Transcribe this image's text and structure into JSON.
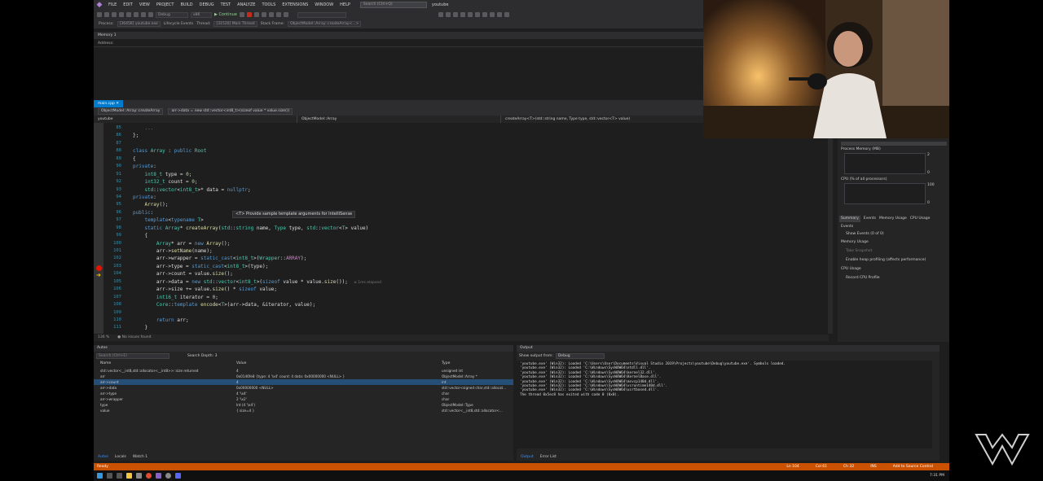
{
  "menu": [
    "FILE",
    "EDIT",
    "VIEW",
    "PROJECT",
    "BUILD",
    "DEBUG",
    "TEST",
    "ANALYZE",
    "TOOLS",
    "EXTENSIONS",
    "WINDOW",
    "HELP"
  ],
  "search_placeholder": "Search (Ctrl+Q)",
  "solution_name": "youtube",
  "toolbar": {
    "config": "Debug",
    "platform": "x86",
    "continue_label": "Continue",
    "stack_label": "Stack Frame:",
    "stack_value": "ObjectModel::Array::createArray<...>"
  },
  "debugbar": {
    "process_label": "Process:",
    "process_value": "[36456] youtube.exe",
    "lifecycle": "Lifecycle Events",
    "thread_label": "Thread:",
    "thread_value": "[31520] Main Thread"
  },
  "memory": {
    "title": "Memory 1",
    "address_label": "Address:"
  },
  "editor": {
    "tab": "main.cpp",
    "nav_project": "ObjectModel::Array::createArray",
    "nav_member": "arr->data = new std::vector<int8_t>(sizeof value * value.size())",
    "nav2": [
      "youtube",
      "ObjectModel::Array",
      "createArray<T>(std::string name, Type type, std::vector<T> value)"
    ],
    "line_numbers": [
      "85",
      "86",
      "87",
      "88",
      "89",
      "90",
      "91",
      "92",
      "93",
      "94",
      "95",
      "96",
      "97",
      "98",
      "99",
      "100",
      "101",
      "102",
      "103",
      "104",
      "105",
      "106",
      "107",
      "108",
      "109",
      "110",
      "111"
    ],
    "tooltip": "<T> Provide sample template arguments for IntelliSense",
    "hint": "≤ 1ms elapsed",
    "zoom": "136 %",
    "issues": "No issues found"
  },
  "diagnostics": {
    "process_memory": "Process Memory (MB)",
    "mem_max": "2",
    "mem_min": "0",
    "cpu": "CPU (% of all processors)",
    "cpu_max": "100",
    "cpu_min": "0",
    "tabs": [
      "Summary",
      "Events",
      "Memory Usage",
      "CPU Usage"
    ],
    "events_title": "Events",
    "show_events": "Show Events (0 of 0)",
    "memory_usage": "Memory Usage",
    "take_snapshot": "Take Snapshot",
    "heap_profiling": "Enable heap profiling (affects performance)",
    "cpu_usage": "CPU Usage",
    "record_cpu": "Record CPU Profile"
  },
  "autos": {
    "title": "Autos",
    "search_placeholder": "Search (Ctrl+E)",
    "depth_label": "Search Depth:",
    "depth_value": "3",
    "headers": [
      "Name",
      "Value",
      "Type"
    ],
    "rows": [
      {
        "name": "std::vector<__int8,std::allocator<__int8>>::size returned",
        "value": "4",
        "type": "unsigned int",
        "sel": false
      },
      {
        "name": "arr",
        "value": "0x0146fe8 {type: 4 '\\x4' count: 4 data: 0x00000000 <NULL> }",
        "type": "ObjectModel::Array *",
        "sel": false
      },
      {
        "name": "arr->count",
        "value": "4",
        "type": "int",
        "sel": true
      },
      {
        "name": "arr->data",
        "value": "0x00000000 <NULL>",
        "type": "std::vector<signed char,std::allocat...",
        "sel": false
      },
      {
        "name": "arr->type",
        "value": "4 '\\x4'",
        "type": "char",
        "sel": false
      },
      {
        "name": "arr->wrapper",
        "value": "2 '\\x2'",
        "type": "char",
        "sel": false
      },
      {
        "name": "type",
        "value": "Int (4 '\\x4')",
        "type": "ObjectModel::Type",
        "sel": false
      },
      {
        "name": "value",
        "value": "{ size=4 }",
        "type": "std::vector<__int8,std::allocator<...",
        "sel": false
      }
    ],
    "bottom_tabs": [
      "Autos",
      "Locals",
      "Watch 1"
    ]
  },
  "output": {
    "title": "Output",
    "from_label": "Show output from:",
    "from_value": "Debug",
    "lines": [
      "'youtube.exe' (Win32): Loaded 'C:\\Users\\User\\Documents\\Visual Studio 2019\\Projects\\youtube\\Debug\\youtube.exe'. Symbols loaded.",
      "'youtube.exe' (Win32): Loaded 'C:\\Windows\\SysWOW64\\ntdll.dll'.",
      "'youtube.exe' (Win32): Loaded 'C:\\Windows\\SysWOW64\\kernel32.dll'.",
      "'youtube.exe' (Win32): Loaded 'C:\\Windows\\SysWOW64\\KernelBase.dll'.",
      "'youtube.exe' (Win32): Loaded 'C:\\Windows\\SysWOW64\\msvcp140d.dll'.",
      "'youtube.exe' (Win32): Loaded 'C:\\Windows\\SysWOW64\\vcruntime140d.dll'.",
      "'youtube.exe' (Win32): Loaded 'C:\\Windows\\SysWOW64\\ucrtbased.dll'.",
      "The thread 0x5ec8 has exited with code 0 (0x0)."
    ],
    "bottom_tabs": [
      "Output",
      "Error List"
    ]
  },
  "status": {
    "ready": "Ready",
    "line": "Ln 104",
    "col": "Col 61",
    "ch": "Ch 32",
    "mode": "INS",
    "source_control": "Add to Source Control"
  },
  "clock": "7:31 PM",
  "colors": {
    "accent": "#007acc",
    "status": "#ca5100",
    "breakpoint": "#e51400"
  }
}
